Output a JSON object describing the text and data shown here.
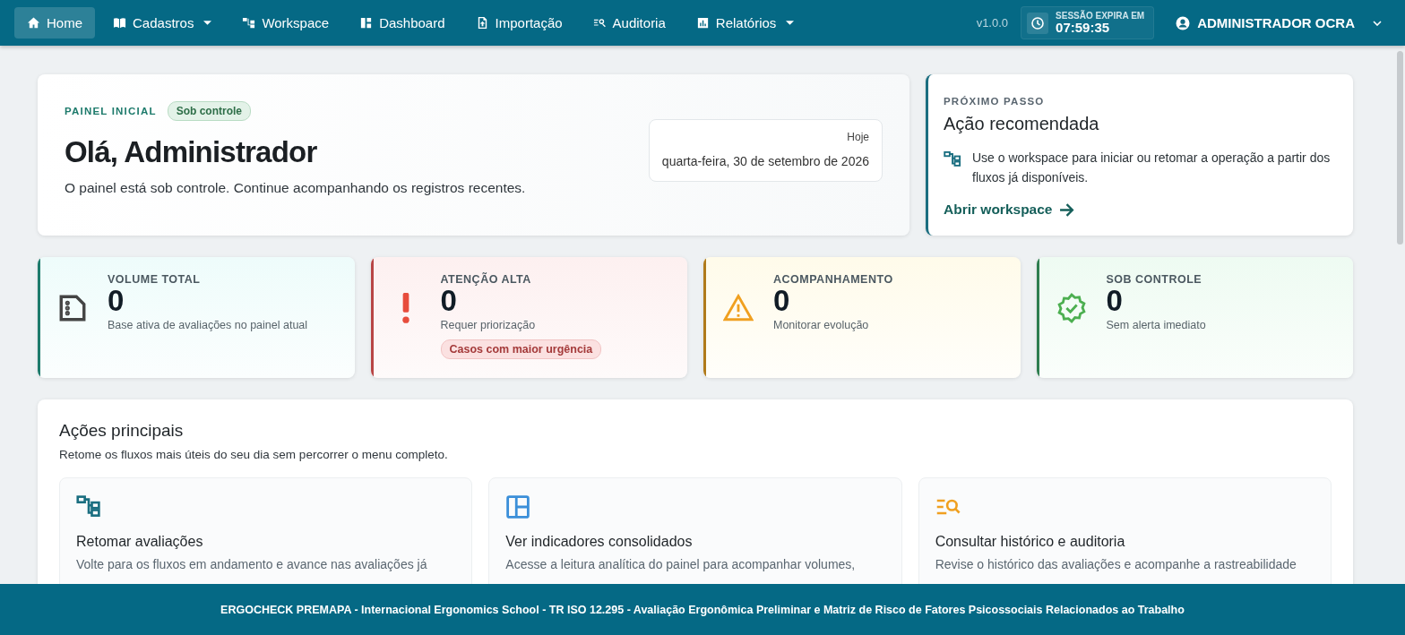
{
  "nav": {
    "items": [
      {
        "label": "Home",
        "kind": "home",
        "selected": true,
        "has_menu": false
      },
      {
        "label": "Cadastros",
        "kind": "book",
        "selected": false,
        "has_menu": true
      },
      {
        "label": "Workspace",
        "kind": "tree",
        "selected": false,
        "has_menu": false
      },
      {
        "label": "Dashboard",
        "kind": "dashboard",
        "selected": false,
        "has_menu": false
      },
      {
        "label": "Importação",
        "kind": "upload",
        "selected": false,
        "has_menu": false
      },
      {
        "label": "Auditoria",
        "kind": "search-list",
        "selected": false,
        "has_menu": false
      },
      {
        "label": "Relatórios",
        "kind": "chart",
        "selected": false,
        "has_menu": true
      }
    ],
    "version": "v1.0.0",
    "session_label": "SESSÃO EXPIRA EM",
    "session_time": "07:59:35",
    "user": "ADMINISTRADOR OCRA"
  },
  "hero": {
    "eyebrow": "PAINEL INICIAL",
    "status": "Sob controle",
    "title": "Olá, Administrador",
    "subtitle": "O painel está sob controle. Continue acompanhando os registros recentes.",
    "date_label": "Hoje",
    "date": "quarta-feira, 30 de setembro de 2026"
  },
  "next_step": {
    "eyebrow": "PRÓXIMO PASSO",
    "title": "Ação recomendada",
    "text": "Use o workspace para iniciar ou retomar a operação a partir dos fluxos já disponíveis.",
    "link": "Abrir workspace"
  },
  "stats": [
    {
      "label": "VOLUME TOTAL",
      "value": "0",
      "note": "Base ativa de avaliações no painel atual",
      "kind": "document",
      "color": "#1d7a6b"
    },
    {
      "label": "ATENÇÃO ALTA",
      "value": "0",
      "note": "Requer priorização",
      "kind": "alert",
      "color": "#b84545",
      "badge": "Casos com maior urgência"
    },
    {
      "label": "ACOMPANHAMENTO",
      "value": "0",
      "note": "Monitorar evolução",
      "kind": "warning",
      "color": "#b07a1a"
    },
    {
      "label": "SOB CONTROLE",
      "value": "0",
      "note": "Sem alerta imediato",
      "kind": "verified",
      "color": "#2e7d4f"
    }
  ],
  "actions": {
    "title": "Ações principais",
    "subtitle": "Retome os fluxos mais úteis do seu dia sem percorrer o menu completo.",
    "cards": [
      {
        "title": "Retomar avaliações",
        "text": "Volte para os fluxos em andamento e avance nas avaliações já",
        "kind": "tree",
        "color": "#1a6e80"
      },
      {
        "title": "Ver indicadores consolidados",
        "text": "Acesse a leitura analítica do painel para acompanhar volumes,",
        "kind": "dashboard",
        "color": "#3b8fd9"
      },
      {
        "title": "Consultar histórico e auditoria",
        "text": "Revise o histórico das avaliações e acompanhe a rastreabilidade",
        "kind": "search-list",
        "color": "#f0a020"
      }
    ]
  },
  "footer": "ERGOCHECK PREMAPA - Internacional Ergonomics School - TR ISO 12.295 - Avaliação Ergonômica Preliminar e Matriz de Risco de Fatores Psicossociais Relacionados ao Trabalho"
}
